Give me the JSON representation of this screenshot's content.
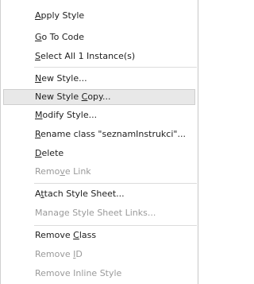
{
  "menu": {
    "items": [
      {
        "id": "apply-style",
        "label": "Apply Style",
        "mnemonic_index": 0,
        "enabled": true
      },
      {
        "id": "go-to-code",
        "label": "Go To Code",
        "mnemonic_index": 0,
        "enabled": true
      },
      {
        "id": "select-all",
        "label": "Select All 1 Instance(s)",
        "mnemonic_index": 0,
        "enabled": true
      },
      {
        "id": "new-style",
        "label": "New Style...",
        "mnemonic_index": 0,
        "enabled": true
      },
      {
        "id": "new-style-copy",
        "label": "New Style Copy...",
        "mnemonic_index": 10,
        "enabled": true,
        "highlighted": true
      },
      {
        "id": "modify-style",
        "label": "Modify Style...",
        "mnemonic_index": 0,
        "enabled": true
      },
      {
        "id": "rename-class",
        "label": "Rename class \"seznamInstrukci\"...",
        "mnemonic_index": 0,
        "enabled": true
      },
      {
        "id": "delete",
        "label": "Delete",
        "mnemonic_index": 0,
        "enabled": true
      },
      {
        "id": "remove-link",
        "label": "Remove Link",
        "mnemonic_index": 4,
        "enabled": false
      },
      {
        "id": "attach-style-sheet",
        "label": "Attach Style Sheet...",
        "mnemonic_index": 1,
        "enabled": true
      },
      {
        "id": "manage-style-sheet-links",
        "label": "Manage Style Sheet Links...",
        "mnemonic_index": null,
        "enabled": false
      },
      {
        "id": "remove-class",
        "label": "Remove Class",
        "mnemonic_index": 7,
        "enabled": true
      },
      {
        "id": "remove-id",
        "label": "Remove ID",
        "mnemonic_index": 7,
        "enabled": false
      },
      {
        "id": "remove-inline-style",
        "label": "Remove Inline Style",
        "mnemonic_index": null,
        "enabled": false
      }
    ]
  }
}
